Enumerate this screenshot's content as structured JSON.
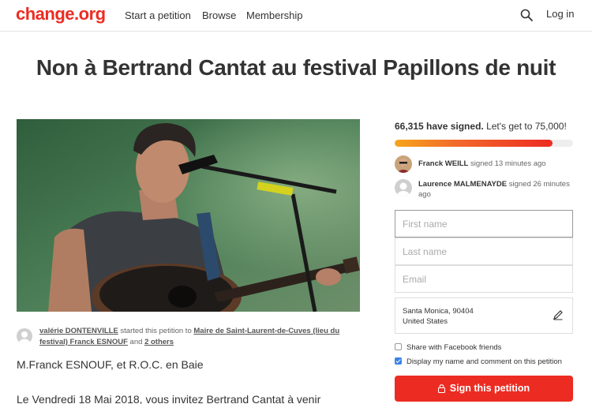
{
  "header": {
    "logo": "change.org",
    "nav": [
      "Start a petition",
      "Browse",
      "Membership"
    ],
    "search_icon": "search-icon",
    "login": "Log in"
  },
  "petition": {
    "title": "Non à Bertrand Cantat au festival Papillons de nuit",
    "hero_image": "Photo of a man singing into a microphone while playing an acoustic guitar",
    "starter": {
      "name": "valérie DONTENVILLE",
      "started_text": " started this petition to ",
      "recipient_link": "Maire de Saint-Laurent-de-Cuves (lieu du festival) Franck ESNOUF",
      "and_text": " and ",
      "others": "2 others"
    },
    "recipient_heading": "M.Franck ESNOUF, et R.O.C. en Baie",
    "body_start": "Le Vendredi 18 Mai 2018, vous invitez Bertrand Cantat à venir"
  },
  "sidebar": {
    "signed_count": "66,315 have signed.",
    "goal_text": "Let's get to 75,000!",
    "progress_fraction": 0.884,
    "recent_signers": [
      {
        "name": "Franck WEILL",
        "time": " signed 13 minutes ago"
      },
      {
        "name": "Laurence MALMENAYDE",
        "time": " signed 26 minutes ago"
      }
    ],
    "form": {
      "first_name_placeholder": "First name",
      "last_name_placeholder": "Last name",
      "email_placeholder": "Email",
      "location_line1": "Santa Monica, 90404",
      "location_line2": "United States"
    },
    "checkboxes": [
      {
        "label": "Share with Facebook friends",
        "checked": false
      },
      {
        "label": "Display my name and comment on this petition",
        "checked": true
      }
    ],
    "sign_button": "Sign this petition"
  },
  "colors": {
    "brand_red": "#ec2c22",
    "progress_start": "#f7a51c",
    "checkbox_blue": "#3b82e8"
  }
}
